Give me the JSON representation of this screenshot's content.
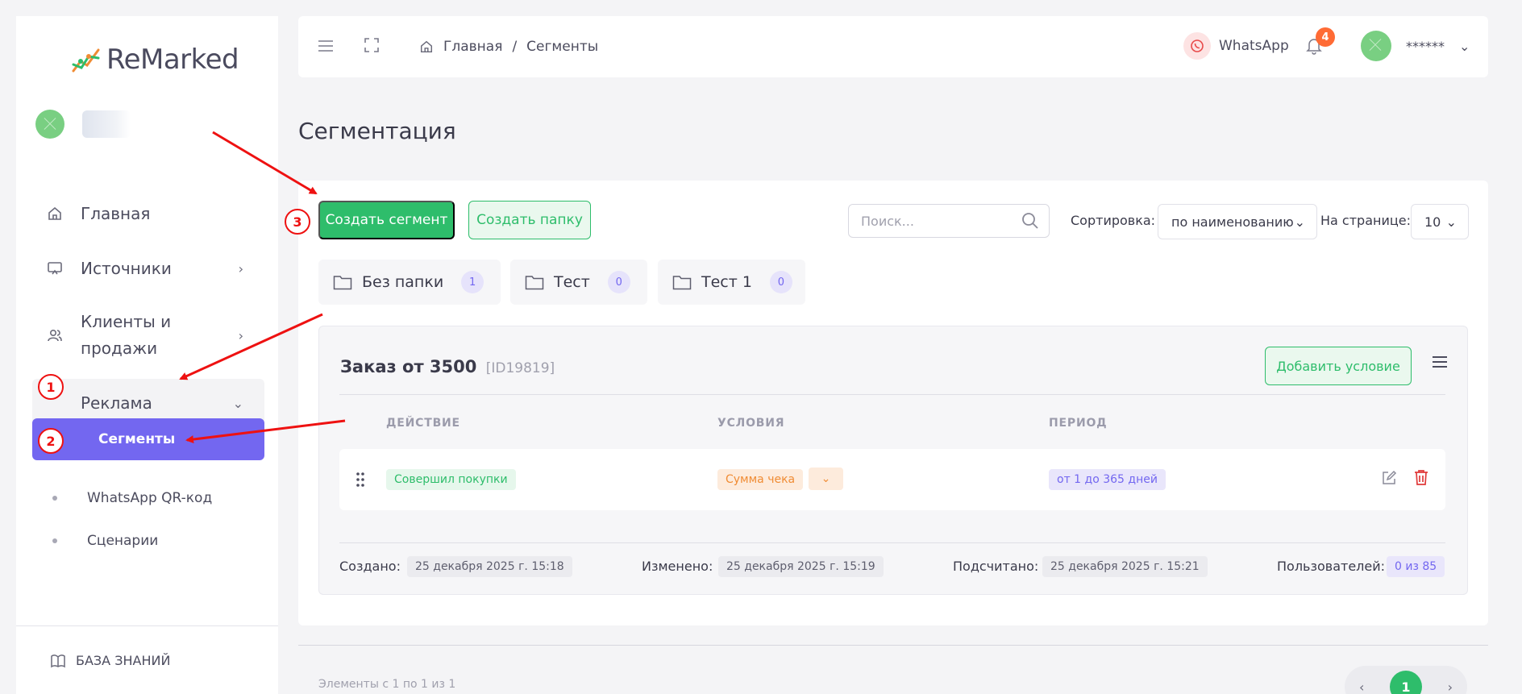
{
  "app": {
    "logo_text": "ReMarked"
  },
  "sidebar": {
    "items": [
      {
        "label": "Главная",
        "icon": "home-icon"
      },
      {
        "label": "Источники",
        "icon": "monitor-icon"
      },
      {
        "label": "Клиенты и продажи",
        "line1": "Клиенты и",
        "line2": "продажи",
        "icon": "users-icon"
      },
      {
        "label": "Реклама",
        "icon": "ad-icon"
      }
    ],
    "subitems": [
      {
        "label": "Сегменты",
        "active": true
      },
      {
        "label": "WhatsApp QR-код"
      },
      {
        "label": "Сценарии"
      }
    ],
    "knowledge_base": "БАЗА ЗНАНИЙ"
  },
  "header": {
    "breadcrumb_home": "Главная",
    "breadcrumb_sep": "/",
    "breadcrumb_current": "Сегменты",
    "whatsapp_label": "WhatsApp",
    "notification_count": "4",
    "user_name": "******"
  },
  "page": {
    "title": "Сегментация"
  },
  "toolbar": {
    "create_segment": "Создать сегмент",
    "create_folder": "Создать папку",
    "search_placeholder": "Поиск...",
    "sort_label": "Сортировка:",
    "sort_value": "по наименованию",
    "per_page_label": "На странице:",
    "per_page_value": "10"
  },
  "folders": [
    {
      "name": "Без папки",
      "count": "1"
    },
    {
      "name": "Тест",
      "count": "0"
    },
    {
      "name": "Тест 1",
      "count": "0"
    }
  ],
  "segment": {
    "title": "Заказ от 3500",
    "id": "[ID19819]",
    "add_condition": "Добавить условие",
    "columns": [
      "ДЕЙСТВИЕ",
      "УСЛОВИЯ",
      "ПЕРИОД"
    ],
    "row": {
      "action": "Совершил покупки",
      "condition": "Сумма чека",
      "period": "от 1 до 365 дней"
    },
    "created_label": "Создано:",
    "created_value": "25 декабря 2025 г. 15:18",
    "modified_label": "Изменено:",
    "modified_value": "25 декабря 2025 г. 15:19",
    "counted_label": "Подсчитано:",
    "counted_value": "25 декабря 2025 г. 15:21",
    "users_label": "Пользователей:",
    "users_value": "0 из 85"
  },
  "pagination": {
    "summary": "Элементы с 1 по 1 из 1",
    "current_page": "1",
    "prev": "‹",
    "next": "›"
  },
  "annotations": [
    "1",
    "2",
    "3"
  ],
  "colors": {
    "primary_green": "#2ebd6b",
    "accent_purple": "#7367f0",
    "annotation_red": "#e11111",
    "badge_orange": "#ff6b35"
  }
}
